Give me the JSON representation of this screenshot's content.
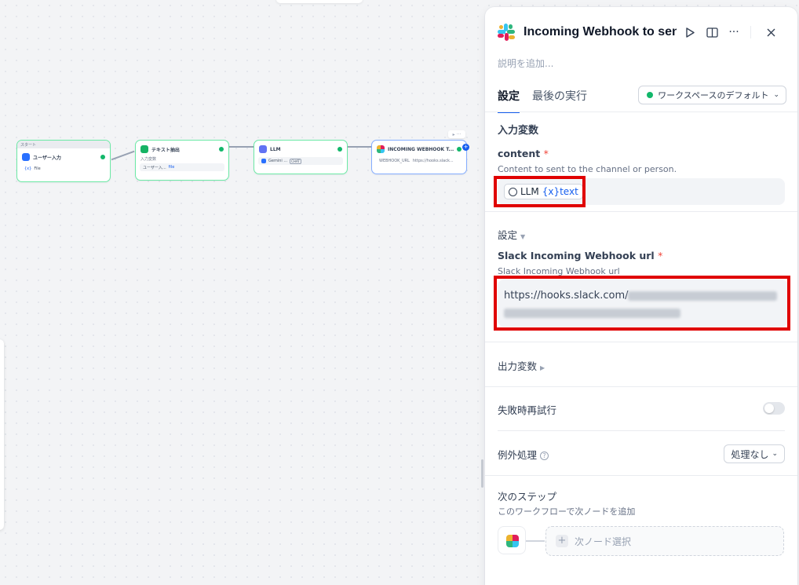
{
  "canvas": {
    "start_node": {
      "bar": "スタート",
      "title": "ユーザー入力",
      "var": "File"
    },
    "text_node": {
      "title": "テキスト抽出",
      "sub": "入力変数",
      "var_src": "ユーザー入...",
      "var": "file"
    },
    "llm_node": {
      "title": "LLM",
      "model": "Gemini ...",
      "badge": "CHAT"
    },
    "slack_node": {
      "title": "INCOMING WEBHOOK T...",
      "param": "WEBHOOK_URL",
      "value": "https://hooks.slack..."
    }
  },
  "panel": {
    "title": "Incoming Webhook to sen",
    "description_placeholder": "説明を追加...",
    "tabs": [
      "設定",
      "最後の実行"
    ],
    "workspace_select": "ワークスペースのデフォルト",
    "input_vars_title": "入力変数",
    "content_label": "content",
    "content_desc": "Content to sent to the channel or person.",
    "content_chip_node": "LLM",
    "content_chip_var": "{x}text",
    "settings_title": "設定",
    "url_label": "Slack Incoming Webhook url",
    "url_desc": "Slack Incoming Webhook url",
    "url_value_prefix": "https://hooks.slack.com/",
    "output_vars_title": "出力変数",
    "retry_title": "失敗時再試行",
    "exception_title": "例外処理",
    "exception_select": "処理なし",
    "next_step_title": "次のステップ",
    "next_step_desc": "このワークフローで次ノードを追加",
    "next_node_select": "次ノード選択"
  },
  "colors": {
    "accent": "#155eef",
    "success": "#12b76a",
    "annotation_red": "#e00000"
  }
}
